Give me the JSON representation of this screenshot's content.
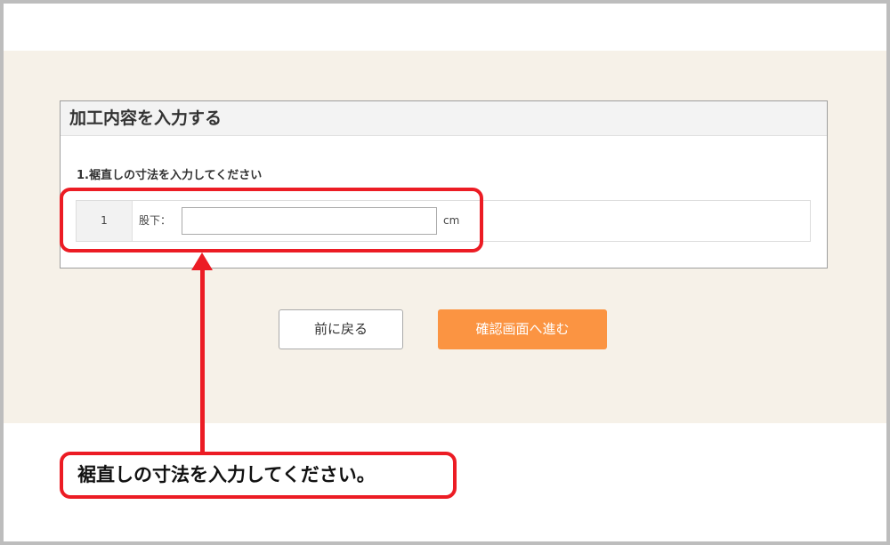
{
  "panel": {
    "title": "加工内容を入力する",
    "question": "1.裾直しの寸法を入力してください"
  },
  "row": {
    "number": "1",
    "label": "股下：",
    "input_value": "",
    "unit": "cm"
  },
  "buttons": {
    "back_label": "前に戻る",
    "next_label": "確認画面へ進む"
  },
  "callout": {
    "text": "裾直しの寸法を入力してください。"
  },
  "colors": {
    "background_section": "#f6f1e8",
    "next_button": "#fb9442",
    "highlight": "#ec1c24"
  }
}
